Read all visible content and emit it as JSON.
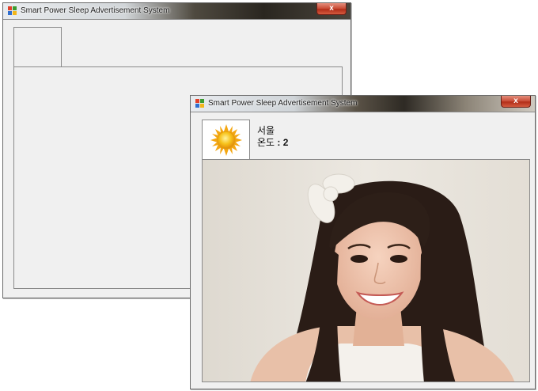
{
  "back_window": {
    "title": "Smart Power Sleep Advertisement System",
    "close_label": "x"
  },
  "front_window": {
    "title": "Smart Power Sleep Advertisement System",
    "close_label": "x",
    "weather": {
      "icon": "sun-icon",
      "city": "서울",
      "temp_label": "온도",
      "temp_separator": " : ",
      "temp_value": "2"
    },
    "advertisement_image": "smiling-woman-photo"
  },
  "colors": {
    "window_bg": "#f0f0f0",
    "close_button": "#c84a34",
    "sun": "#f6b40e"
  }
}
